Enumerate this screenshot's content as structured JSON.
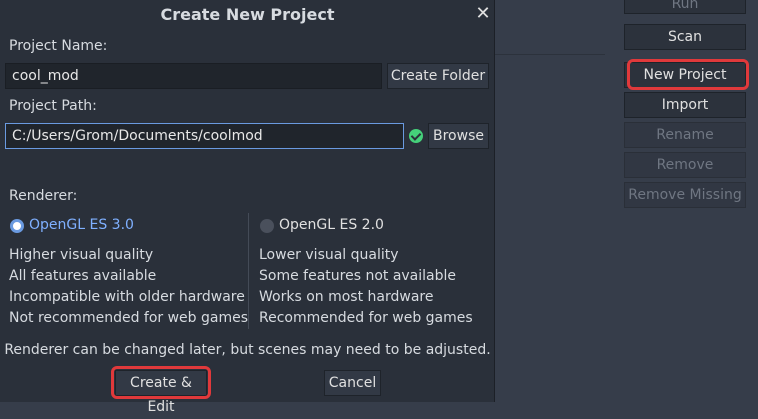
{
  "dialog": {
    "title": "Create New Project",
    "close_glyph": "✕",
    "project_name_label": "Project Name:",
    "project_name_value": "cool_mod",
    "create_folder_label": "Create Folder",
    "project_path_label": "Project Path:",
    "project_path_value": "C:/Users/Grom/Documents/coolmod",
    "browse_label": "Browse",
    "renderer_label": "Renderer:",
    "renderers": [
      {
        "name": "OpenGL ES 3.0",
        "selected": true,
        "features": [
          "Higher visual quality",
          "All features available",
          "Incompatible with older hardware",
          "Not recommended for web games"
        ]
      },
      {
        "name": "OpenGL ES 2.0",
        "selected": false,
        "features": [
          "Lower visual quality",
          "Some features not available",
          "Works on most hardware",
          "Recommended for web games"
        ]
      }
    ],
    "renderer_note": "Renderer can be changed later, but scenes may need to be adjusted.",
    "create_edit_label": "Create & Edit",
    "cancel_label": "Cancel"
  },
  "sidebar": {
    "run_label": "Run",
    "scan_label": "Scan",
    "new_project_label": "New Project",
    "import_label": "Import",
    "rename_label": "Rename",
    "remove_label": "Remove",
    "remove_missing_label": "Remove Missing"
  },
  "colors": {
    "accent": "#6a9ae0",
    "highlight": "#e0393b",
    "valid": "#45d07a"
  }
}
